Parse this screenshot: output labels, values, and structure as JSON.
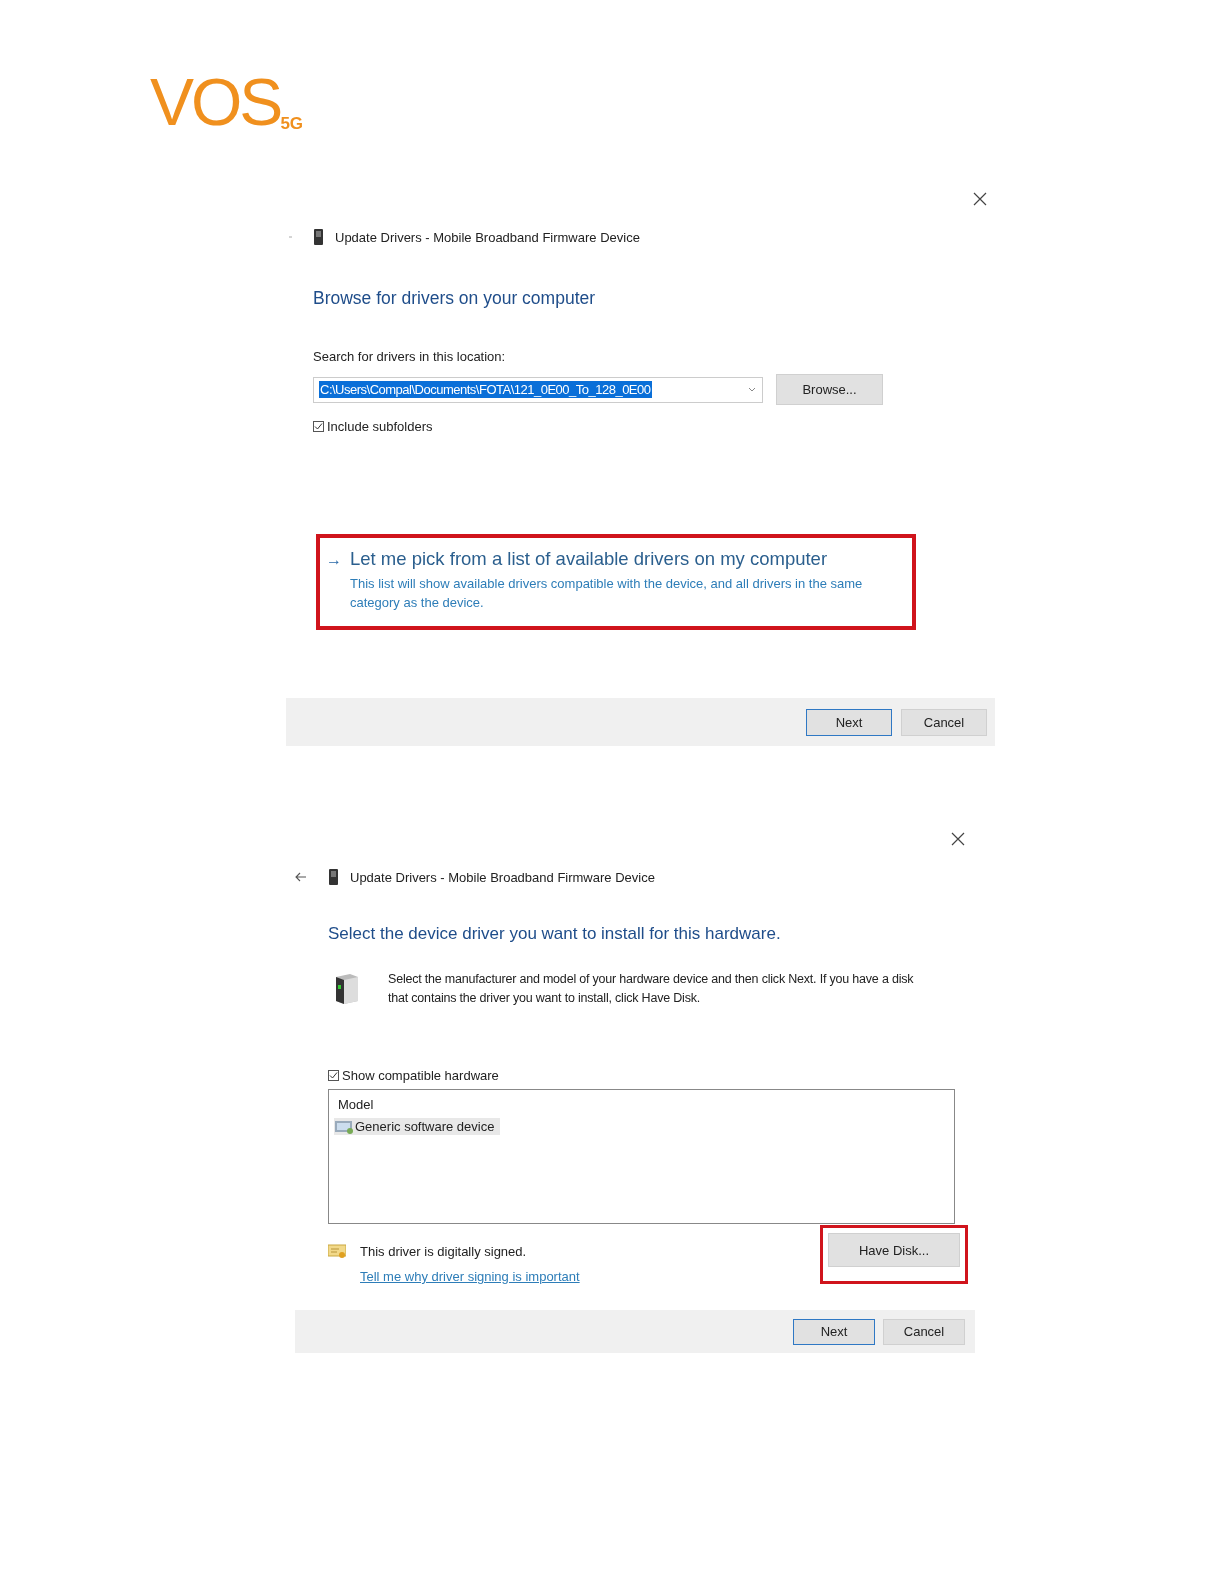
{
  "logo": {
    "text": "VOS",
    "sub": "5G"
  },
  "dialogs": [
    {
      "kind": "browse",
      "title": "Update Drivers - Mobile Broadband Firmware Device",
      "back_enabled": false,
      "heading": "Browse for drivers on your computer",
      "location_label": "Search for drivers in this location:",
      "location_value": "C:\\Users\\Compal\\Documents\\FOTA\\121_0E00_To_128_0E00",
      "location_selected": true,
      "browse_button": "Browse...",
      "include_subfolders": {
        "label": "Include subfolders",
        "checked": true
      },
      "option": {
        "arrow": "→",
        "title": "Let me pick from a list of available drivers on my computer",
        "description": "This list will show available drivers compatible with the device, and all drivers in the same category as the device.",
        "highlighted": true
      },
      "buttons": [
        {
          "label": "Next",
          "default": true
        },
        {
          "label": "Cancel",
          "default": false
        }
      ]
    },
    {
      "kind": "select",
      "title": "Update Drivers - Mobile Broadband Firmware Device",
      "back_enabled": true,
      "heading": "Select the device driver you want to install for this hardware.",
      "instruction": "Select the manufacturer and model of your hardware device and then click Next. If you have a disk that contains the driver you want to install, click Have Disk.",
      "show_compatible": {
        "label": "Show compatible hardware",
        "checked": true
      },
      "list": {
        "column": "Model",
        "items": [
          {
            "label": "Generic software device",
            "selected": true
          }
        ]
      },
      "signed_text": "This driver is digitally signed.",
      "signing_link": "Tell me why driver signing is important",
      "have_disk": {
        "label": "Have Disk...",
        "highlighted": true
      },
      "buttons": [
        {
          "label": "Next",
          "default": true
        },
        {
          "label": "Cancel",
          "default": false
        }
      ]
    }
  ]
}
